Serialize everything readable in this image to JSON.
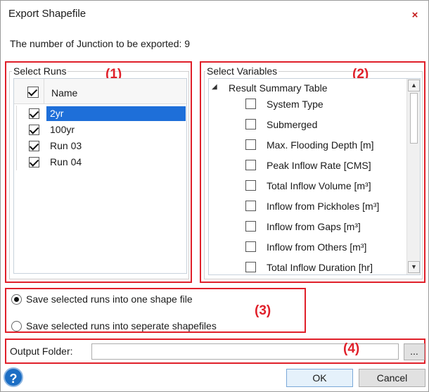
{
  "window": {
    "title": "Export Shapefile",
    "close_glyph": "×"
  },
  "info": {
    "junction_count_text": "The number of Junction to be exported: 9"
  },
  "runs": {
    "legend": "Select Runs",
    "marker": "(1)",
    "header_label": "Name",
    "header_checked": true,
    "items": [
      {
        "label": "2yr",
        "checked": true,
        "selected": true
      },
      {
        "label": "100yr",
        "checked": true,
        "selected": false
      },
      {
        "label": "Run 03",
        "checked": true,
        "selected": false
      },
      {
        "label": "Run 04",
        "checked": true,
        "selected": false
      }
    ]
  },
  "variables": {
    "legend": "Select Variables",
    "marker": "(2)",
    "group_label": "Result Summary Table",
    "group_expander": "◢",
    "items": [
      {
        "label": "System Type",
        "checked": false
      },
      {
        "label": "Submerged",
        "checked": false
      },
      {
        "label": "Max. Flooding Depth [m]",
        "checked": false
      },
      {
        "label": "Peak Inflow Rate [CMS]",
        "checked": false
      },
      {
        "label": "Total Inflow Volume [m³]",
        "checked": false
      },
      {
        "label": "Inflow from Pickholes [m³]",
        "checked": false
      },
      {
        "label": "Inflow from Gaps [m³]",
        "checked": false
      },
      {
        "label": "Inflow from Others [m³]",
        "checked": false
      },
      {
        "label": "Total Inflow Duration [hr]",
        "checked": false
      }
    ],
    "scroll_up": "▲",
    "scroll_down": "▼"
  },
  "save_mode": {
    "marker": "(3)",
    "options": [
      {
        "label": "Save selected runs into one shape file",
        "selected": true
      },
      {
        "label": "Save selected runs into seperate shapefiles",
        "selected": false
      }
    ]
  },
  "output": {
    "marker": "(4)",
    "label": "Output Folder:",
    "value": "",
    "browse_label": "..."
  },
  "buttons": {
    "ok": "OK",
    "cancel": "Cancel",
    "help": "?"
  },
  "colors": {
    "annotation_red": "#e0202a",
    "selection_blue": "#1e6fd9",
    "help_blue": "#1c6ec4"
  }
}
